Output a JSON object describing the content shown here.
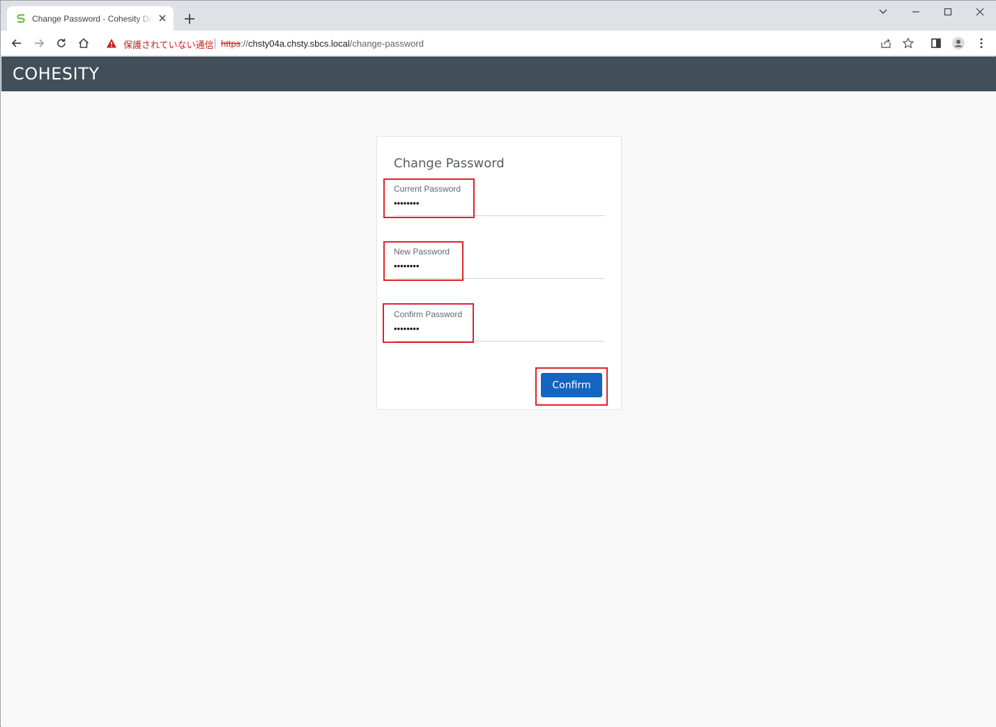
{
  "browser": {
    "tab": {
      "title": "Change Password - Cohesity Dashboard"
    },
    "address_bar": {
      "security_label": "保護されていない通信",
      "url_scheme": "https",
      "url_sep": "://",
      "url_host": "chsty04a.chsty.sbcs.local",
      "url_path": "/change-password"
    }
  },
  "app": {
    "logo": "COHESITY",
    "brand_color": "#424f58",
    "accent_color": "#1565c0"
  },
  "form": {
    "title": "Change Password",
    "fields": [
      {
        "label": "Current Password",
        "value": "••••••••"
      },
      {
        "label": "New Password",
        "value": "••••••••"
      },
      {
        "label": "Confirm Password",
        "value": "••••••••"
      }
    ],
    "confirm_label": "Confirm"
  },
  "annotations": {
    "highlight_color": "#e0202a"
  }
}
